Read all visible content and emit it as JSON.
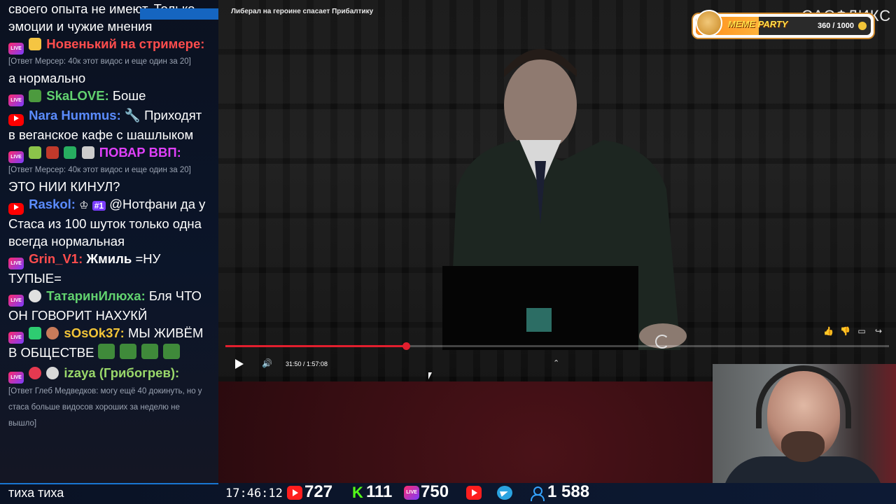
{
  "chat": {
    "messages": [
      {
        "user": "",
        "text": "своего опыта не имеют. Только эмоции и чужие мнения",
        "badges": []
      },
      {
        "user": "Новенький на стримере:",
        "user_color": "#ff4d4d",
        "reply": "[Ответ Мерсер: 40к этот видос и еще один за 20]",
        "text": "а нормально",
        "badges": [
          "live"
        ]
      },
      {
        "user": "SkaLOVE:",
        "user_color": "#62d26f",
        "text": "Боше",
        "badges": [
          "live"
        ]
      },
      {
        "user": "Nara Hummus:",
        "user_color": "#5b8cff",
        "text": "Приходят в веганское кафе с шашлыком",
        "badges": [
          "youtube"
        ]
      },
      {
        "user": "ПОВАР ВВП:",
        "user_color": "#e040fb",
        "reply": "[Ответ Мерсер: 40к этот видос и еще один за 20]",
        "text": "ЭТО НИИ КИНУЛ?",
        "badges": [
          "live"
        ]
      },
      {
        "user": "Raskol:",
        "user_color": "#5b8cff",
        "rank": "#1",
        "text": "@Нотфани да у Стаса из 100 шуток только одна всегда нормальная",
        "badges": [
          "youtube"
        ]
      },
      {
        "user": "Grin_V1:",
        "user_color": "#ff4d4d",
        "bold": "Жмиль",
        "text": "=НУ ТУПЫЕ=",
        "badges": [
          "live"
        ]
      },
      {
        "user": "ТатаринИлюха:",
        "user_color": "#62d26f",
        "text": "Бля ЧТО ОН ГОВОРИТ НАХУКЙ",
        "badges": [
          "live"
        ]
      },
      {
        "user": "sOsOk37:",
        "user_color": "#f2c438",
        "text": "МЫ ЖИВЁМ В ОБЩЕСТВЕ",
        "badges": [
          "live"
        ]
      },
      {
        "user": "izaya (Грибогрев):",
        "user_color": "#9ad86a",
        "reply": "[Ответ Глеб Медведков: могу ещё 40 докинуть, но у стаса больше видосов хороших за неделю не вышло]",
        "text": "",
        "badges": [
          "live"
        ]
      }
    ],
    "last_message": "тиха тиха"
  },
  "video": {
    "title": "Либерал на героине спасает Прибалтику",
    "time": "31:50 / 1:57:08",
    "progress": 0.272,
    "icons": [
      "like-icon",
      "dislike-icon",
      "comment-icon",
      "share-icon"
    ]
  },
  "widget": {
    "title": "MEME PARTY",
    "count": "360 / 1000",
    "fill": 0.36
  },
  "brand": "САСФЛИКС",
  "stats": {
    "clock": "17:46:12",
    "youtube": "727",
    "kick": "111",
    "live": "750",
    "viewers": "1 588"
  },
  "colors": {
    "accent": "#e21f2e",
    "chat_bg": "#0b1120",
    "youtube_red": "#ff0000",
    "kick_green": "#53fc18",
    "telegram_blue": "#2aa3e0"
  }
}
